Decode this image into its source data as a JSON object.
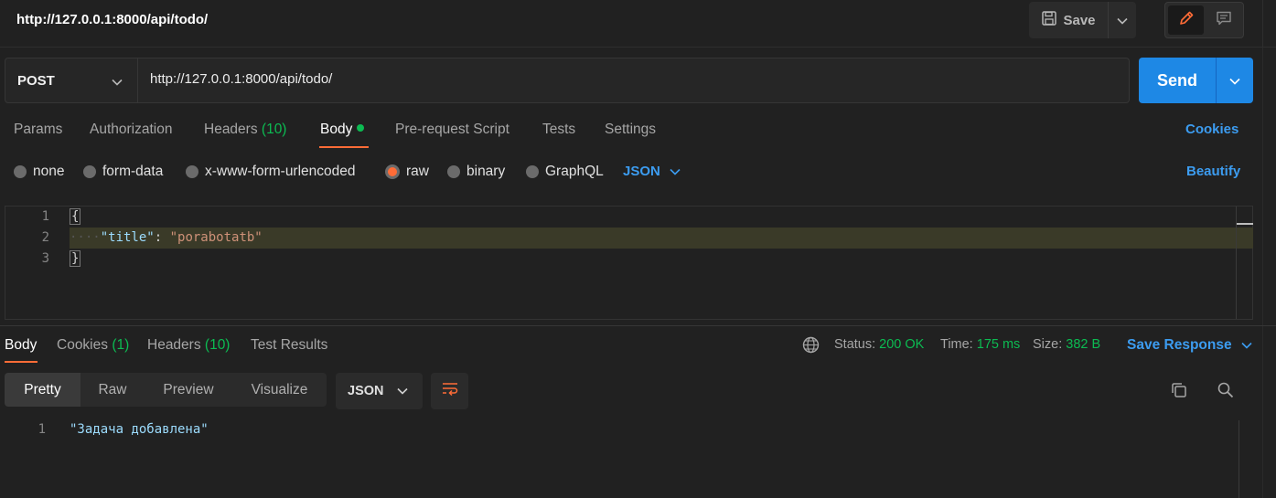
{
  "header": {
    "title": "http://127.0.0.1:8000/api/todo/",
    "save_label": "Save"
  },
  "request": {
    "method": "POST",
    "url": "http://127.0.0.1:8000/api/todo/",
    "send_label": "Send"
  },
  "request_tabs": {
    "params": "Params",
    "authorization": "Authorization",
    "headers": "Headers",
    "headers_count": "(10)",
    "body": "Body",
    "pre_request": "Pre-request Script",
    "tests": "Tests",
    "settings": "Settings",
    "cookies": "Cookies"
  },
  "body_types": {
    "none": "none",
    "form_data": "form-data",
    "urlencoded": "x-www-form-urlencoded",
    "raw": "raw",
    "binary": "binary",
    "graphql": "GraphQL",
    "selected": "raw",
    "language": "JSON",
    "beautify": "Beautify"
  },
  "editor": {
    "line_numbers": [
      "1",
      "2",
      "3"
    ],
    "open_brace": "{",
    "indent": "····",
    "key": "\"title\"",
    "colon": ": ",
    "value": "\"porabotatb\"",
    "close_brace": "}"
  },
  "response_tabs": {
    "body": "Body",
    "cookies": "Cookies",
    "cookies_count": "(1)",
    "headers": "Headers",
    "headers_count": "(10)",
    "test_results": "Test Results"
  },
  "response_meta": {
    "status_label": "Status:",
    "status_value": "200 OK",
    "time_label": "Time:",
    "time_value": "175 ms",
    "size_label": "Size:",
    "size_value": "382 B",
    "save_response": "Save Response"
  },
  "response_view": {
    "pretty": "Pretty",
    "raw": "Raw",
    "preview": "Preview",
    "visualize": "Visualize",
    "format": "JSON"
  },
  "response_body": {
    "line_number": "1",
    "text": "\"Задача добавлена\""
  },
  "colors": {
    "accent_orange": "#ff6c37",
    "send_blue": "#1e88e5",
    "link_blue": "#3c9cf0",
    "success_green": "#0cbb52"
  },
  "icons": [
    "save-icon",
    "chevron-down-icon",
    "pencil-icon",
    "comment-icon",
    "globe-icon",
    "wrap-lines-icon",
    "copy-icon",
    "search-icon"
  ]
}
